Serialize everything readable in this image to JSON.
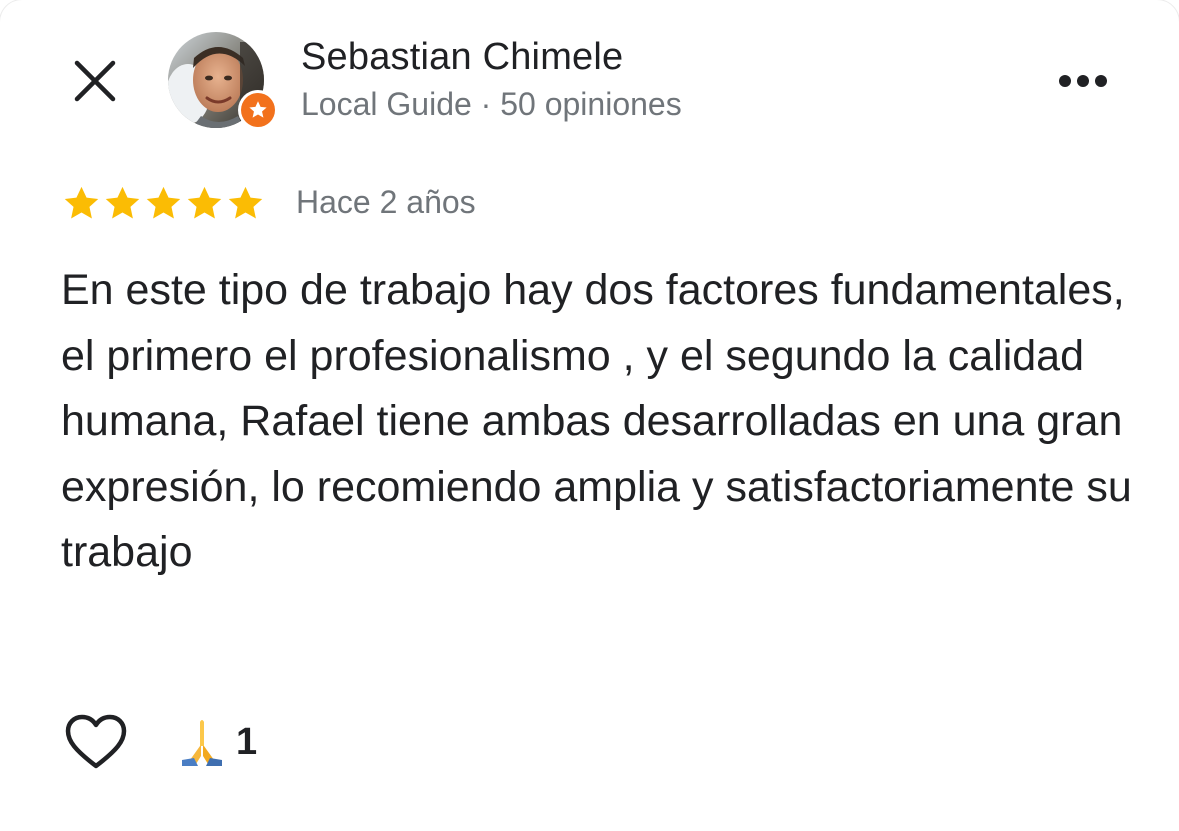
{
  "header": {
    "author_name": "Sebastian Chimele",
    "author_meta": "Local Guide · 50 opiniones",
    "close_icon": "close-icon",
    "more_icon": "more-horizontal-icon",
    "badge_icon": "local-guide-star-badge-icon",
    "badge_color": "#f2711c"
  },
  "review": {
    "rating": 5,
    "rating_max": 5,
    "star_color": "#fbbc04",
    "date": "Hace 2 años",
    "text": "En este tipo de trabajo hay dos factores fundamentales, el primero el profesionalismo , y el segundo la calidad humana, Rafael tiene ambas desarrolladas en una gran expresión, lo recomiendo amplia y satisfactoriamente su trabajo"
  },
  "actions": {
    "like_icon": "heart-outline-icon",
    "reaction_emoji": "🙏",
    "reaction_count": "1"
  }
}
